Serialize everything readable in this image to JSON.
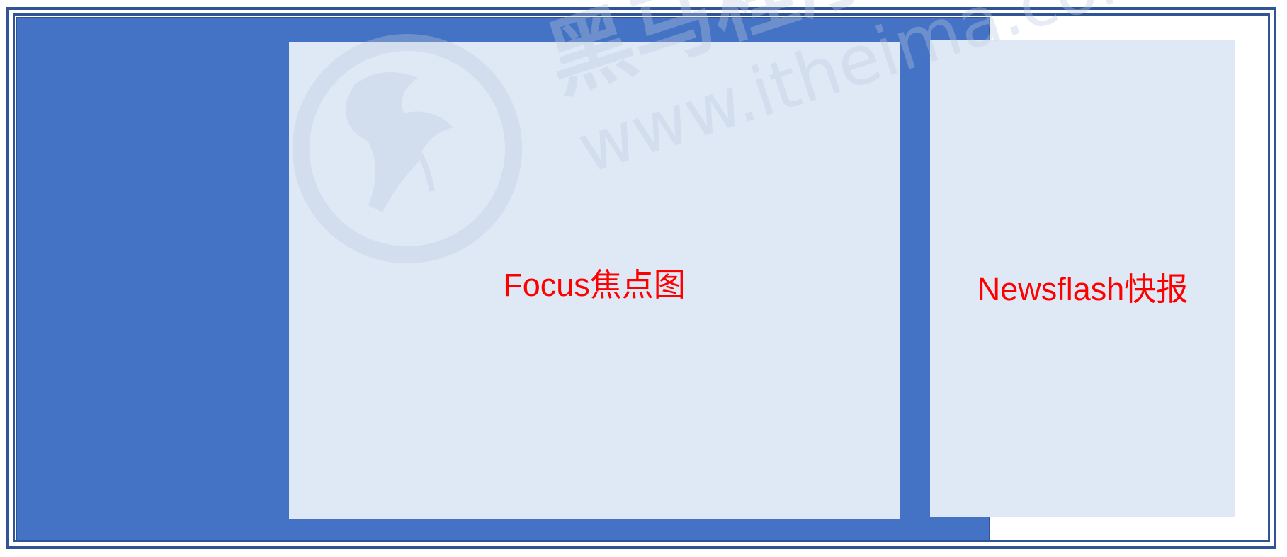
{
  "diagram": {
    "focus_label": "Focus焦点图",
    "newsflash_label": "Newsflash快报"
  },
  "watermark": {
    "text_cn": "黑马程序员",
    "text_url": "www.itheima.com"
  },
  "colors": {
    "container_fill": "#4472c4",
    "container_border": "#2f5597",
    "box_fill": "#dfe9f5",
    "label_color": "#ff0000",
    "watermark_color": "#c9d6e6"
  }
}
